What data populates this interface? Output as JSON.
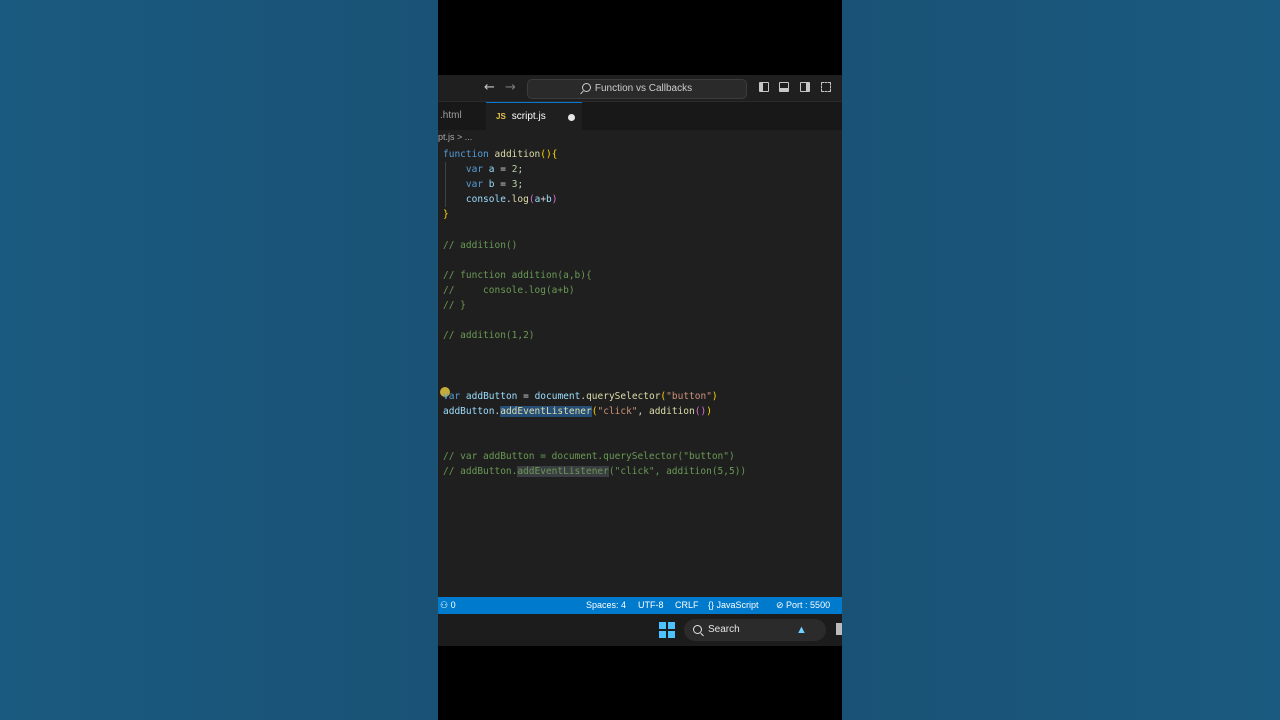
{
  "window": {
    "title": "Function vs Callbacks",
    "back_arrow": "←",
    "forward_arrow": "→"
  },
  "tabs": [
    {
      "label": ".html",
      "active": false
    },
    {
      "label": "script.js",
      "badge": "JS",
      "active": true,
      "modified": true
    }
  ],
  "breadcrumb": "pt.js > ...",
  "code": {
    "l1": [
      "function",
      " ",
      "addition",
      "(",
      ")",
      "{"
    ],
    "l2": [
      "    ",
      "var",
      " ",
      "a",
      " = ",
      "2",
      ";"
    ],
    "l3": [
      "    ",
      "var",
      " ",
      "b",
      " = ",
      "3",
      ";"
    ],
    "l4": [
      "    ",
      "console",
      ".",
      "log",
      "(",
      "a",
      "+",
      "b",
      ")"
    ],
    "l5": "}",
    "c1": "// addition()",
    "c2": "// function addition(a,b){",
    "c3": "//     console.log(a+b)",
    "c4": "// }",
    "c5": "// addition(1,2)",
    "l6": [
      "var",
      " ",
      "addButton",
      " = ",
      "document",
      ".",
      "querySelector",
      "(",
      "\"button\"",
      ")"
    ],
    "l7": [
      "addButton",
      ".",
      "addEventListener",
      "(",
      "\"click\"",
      ", ",
      "addition",
      "(",
      ")",
      ")"
    ],
    "c6": "// var addButton = document.querySelector(\"button\")",
    "c7a": "// addButton.",
    "c7b": "addEventListener",
    "c7c": "(\"click\", addition(5,5))"
  },
  "statusbar": {
    "remote": "0",
    "spaces": "Spaces: 4",
    "encoding": "UTF-8",
    "eol": "CRLF",
    "language": "{} JavaScript",
    "port": "Port : 5500"
  },
  "taskbar": {
    "search_label": "Search"
  },
  "colors": {
    "statusbar": "#007acc",
    "editor_bg": "#1f1f1f",
    "comment": "#6a9955",
    "keyword": "#569cd6"
  }
}
